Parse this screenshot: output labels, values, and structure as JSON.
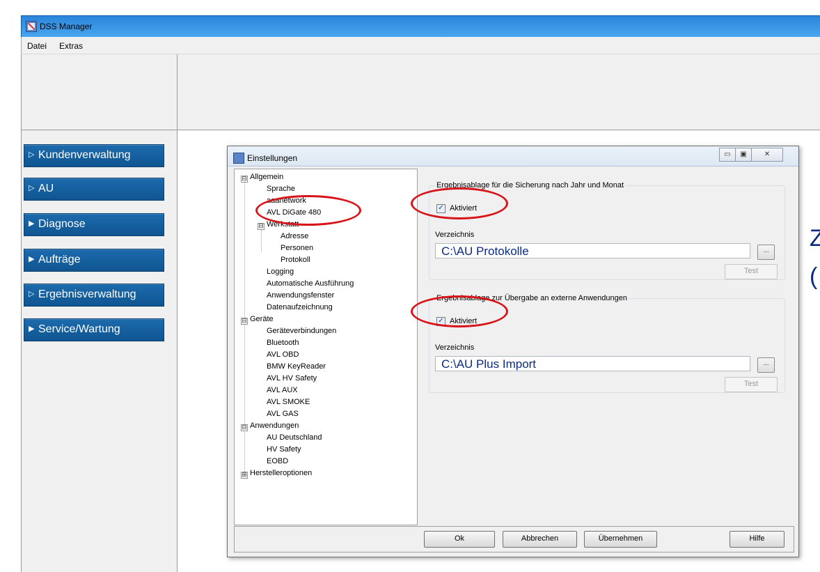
{
  "main_window": {
    "title": "DSS Manager",
    "menu": [
      "Datei",
      "Extras"
    ]
  },
  "nav": {
    "items": [
      {
        "label": "Kundenverwaltung",
        "arrow": "▷"
      },
      {
        "label": "AU",
        "arrow": "▷"
      },
      {
        "label": "Diagnose",
        "arrow": "▶"
      },
      {
        "label": "Aufträge",
        "arrow": "▶"
      },
      {
        "label": "Ergebnisverwaltung",
        "arrow": "▷"
      },
      {
        "label": "Service/Wartung",
        "arrow": "▶"
      }
    ]
  },
  "background_text": [
    "Z",
    "("
  ],
  "dialog": {
    "title": "Einstellungen",
    "window_buttons": [
      "▭",
      "▣",
      "✕"
    ],
    "tree": [
      {
        "label": "Allgemein",
        "expander": "⊟"
      },
      {
        "label": "Sprache"
      },
      {
        "label": "aaanetwork"
      },
      {
        "label": "AVL DiGate 480"
      },
      {
        "label": "Werkstatt",
        "expander": "⊟"
      },
      {
        "label": "Adresse"
      },
      {
        "label": "Personen"
      },
      {
        "label": "Protokoll"
      },
      {
        "label": "Logging"
      },
      {
        "label": "Automatische Ausführung"
      },
      {
        "label": "Anwendungsfenster"
      },
      {
        "label": "Datenaufzeichnung"
      },
      {
        "label": "Geräte",
        "expander": "⊟"
      },
      {
        "label": "Geräteverbindungen"
      },
      {
        "label": "Bluetooth"
      },
      {
        "label": "AVL OBD"
      },
      {
        "label": "BMW KeyReader"
      },
      {
        "label": "AVL HV Safety"
      },
      {
        "label": "AVL AUX"
      },
      {
        "label": "AVL SMOKE"
      },
      {
        "label": "AVL GAS"
      },
      {
        "label": "Anwendungen",
        "expander": "⊟"
      },
      {
        "label": "AU Deutschland"
      },
      {
        "label": "HV Safety"
      },
      {
        "label": "EOBD"
      },
      {
        "label": "Herstelleroptionen",
        "expander": "⊞"
      }
    ],
    "groups": [
      {
        "title": "Ergebnisablage für die Sicherung nach Jahr und Monat",
        "checkbox_label": "Aktiviert",
        "checkbox_mark": "✓",
        "dir_label": "Verzeichnis",
        "dir_value": "C:\\AU Protokolle",
        "browse_label": "...",
        "test_label": "Test"
      },
      {
        "title": "Ergebnisablage zur Übergabe an externe Anwendungen",
        "checkbox_label": "Aktiviert",
        "checkbox_mark": "✓",
        "dir_label": "Verzeichnis",
        "dir_value": "C:\\AU Plus Import",
        "browse_label": "...",
        "test_label": "Test"
      }
    ],
    "footer": {
      "ok": "Ok",
      "cancel": "Abbrechen",
      "apply": "Übernehmen",
      "help": "Hilfe"
    }
  },
  "accent_colors": {
    "titlebar": "#2a84d9",
    "nav_button": "#1c6aad",
    "annotation_red": "#d8141b",
    "dir_text": "#0a2a80"
  }
}
